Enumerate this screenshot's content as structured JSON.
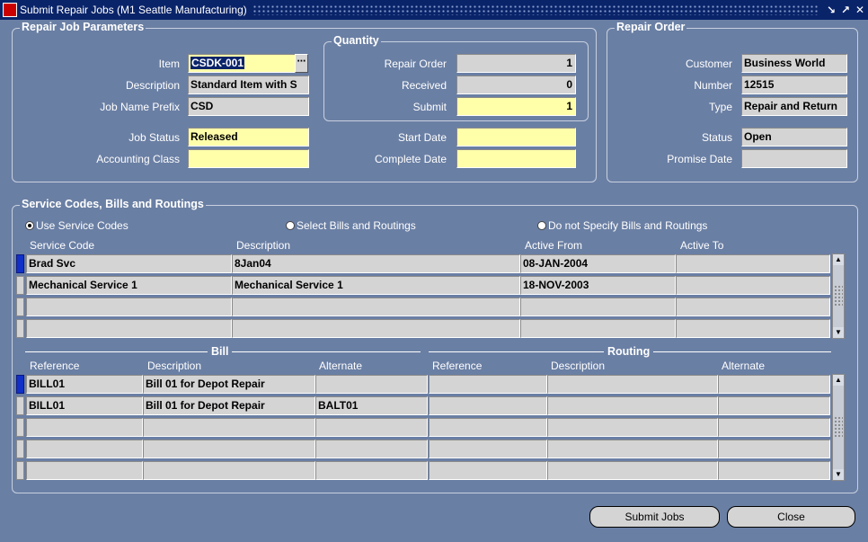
{
  "window": {
    "title": "Submit Repair Jobs (M1 Seattle Manufacturing)"
  },
  "params": {
    "title": "Repair Job Parameters",
    "item_label": "Item",
    "item_value": "CSDK-001",
    "description_label": "Description",
    "description_value": "Standard Item with S",
    "prefix_label": "Job Name Prefix",
    "prefix_value": "CSD",
    "status_label": "Job Status",
    "status_value": "Released",
    "class_label": "Accounting Class",
    "class_value": "",
    "start_label": "Start Date",
    "start_value": "",
    "complete_label": "Complete Date",
    "complete_value": ""
  },
  "quantity": {
    "title": "Quantity",
    "repair_order_label": "Repair Order",
    "repair_order_value": "1",
    "received_label": "Received",
    "received_value": "0",
    "submit_label": "Submit",
    "submit_value": "1"
  },
  "repair_order": {
    "title": "Repair Order",
    "customer_label": "Customer",
    "customer_value": "Business World",
    "number_label": "Number",
    "number_value": "12515",
    "type_label": "Type",
    "type_value": "Repair and Return",
    "status_label": "Status",
    "status_value": "Open",
    "promise_label": "Promise Date",
    "promise_value": ""
  },
  "service": {
    "title": "Service Codes, Bills and Routings",
    "radio_use": "Use Service Codes",
    "radio_select": "Select Bills and Routings",
    "radio_none": "Do not Specify Bills and Routings",
    "selected_radio": "use",
    "columns": [
      "Service Code",
      "Description",
      "Active  From",
      "Active To"
    ],
    "rows": [
      [
        "Brad Svc",
        "8Jan04",
        "08-JAN-2004",
        ""
      ],
      [
        "Mechanical Service 1",
        "Mechanical Service 1",
        "18-NOV-2003",
        ""
      ],
      [
        "",
        "",
        "",
        ""
      ],
      [
        "",
        "",
        "",
        ""
      ]
    ]
  },
  "bills": {
    "bill_title": "Bill",
    "routing_title": "Routing",
    "columns": [
      "Reference",
      "Description",
      "Alternate",
      "Reference",
      "Description",
      "Alternate"
    ],
    "rows": [
      [
        "BILL01",
        "Bill 01 for Depot Repair",
        "",
        "",
        "",
        ""
      ],
      [
        "BILL01",
        "Bill 01 for Depot Repair",
        "BALT01",
        "",
        "",
        ""
      ],
      [
        "",
        "",
        "",
        "",
        "",
        ""
      ],
      [
        "",
        "",
        "",
        "",
        "",
        ""
      ],
      [
        "",
        "",
        "",
        "",
        "",
        ""
      ]
    ]
  },
  "buttons": {
    "submit": "Submit Jobs",
    "close": "Close"
  }
}
